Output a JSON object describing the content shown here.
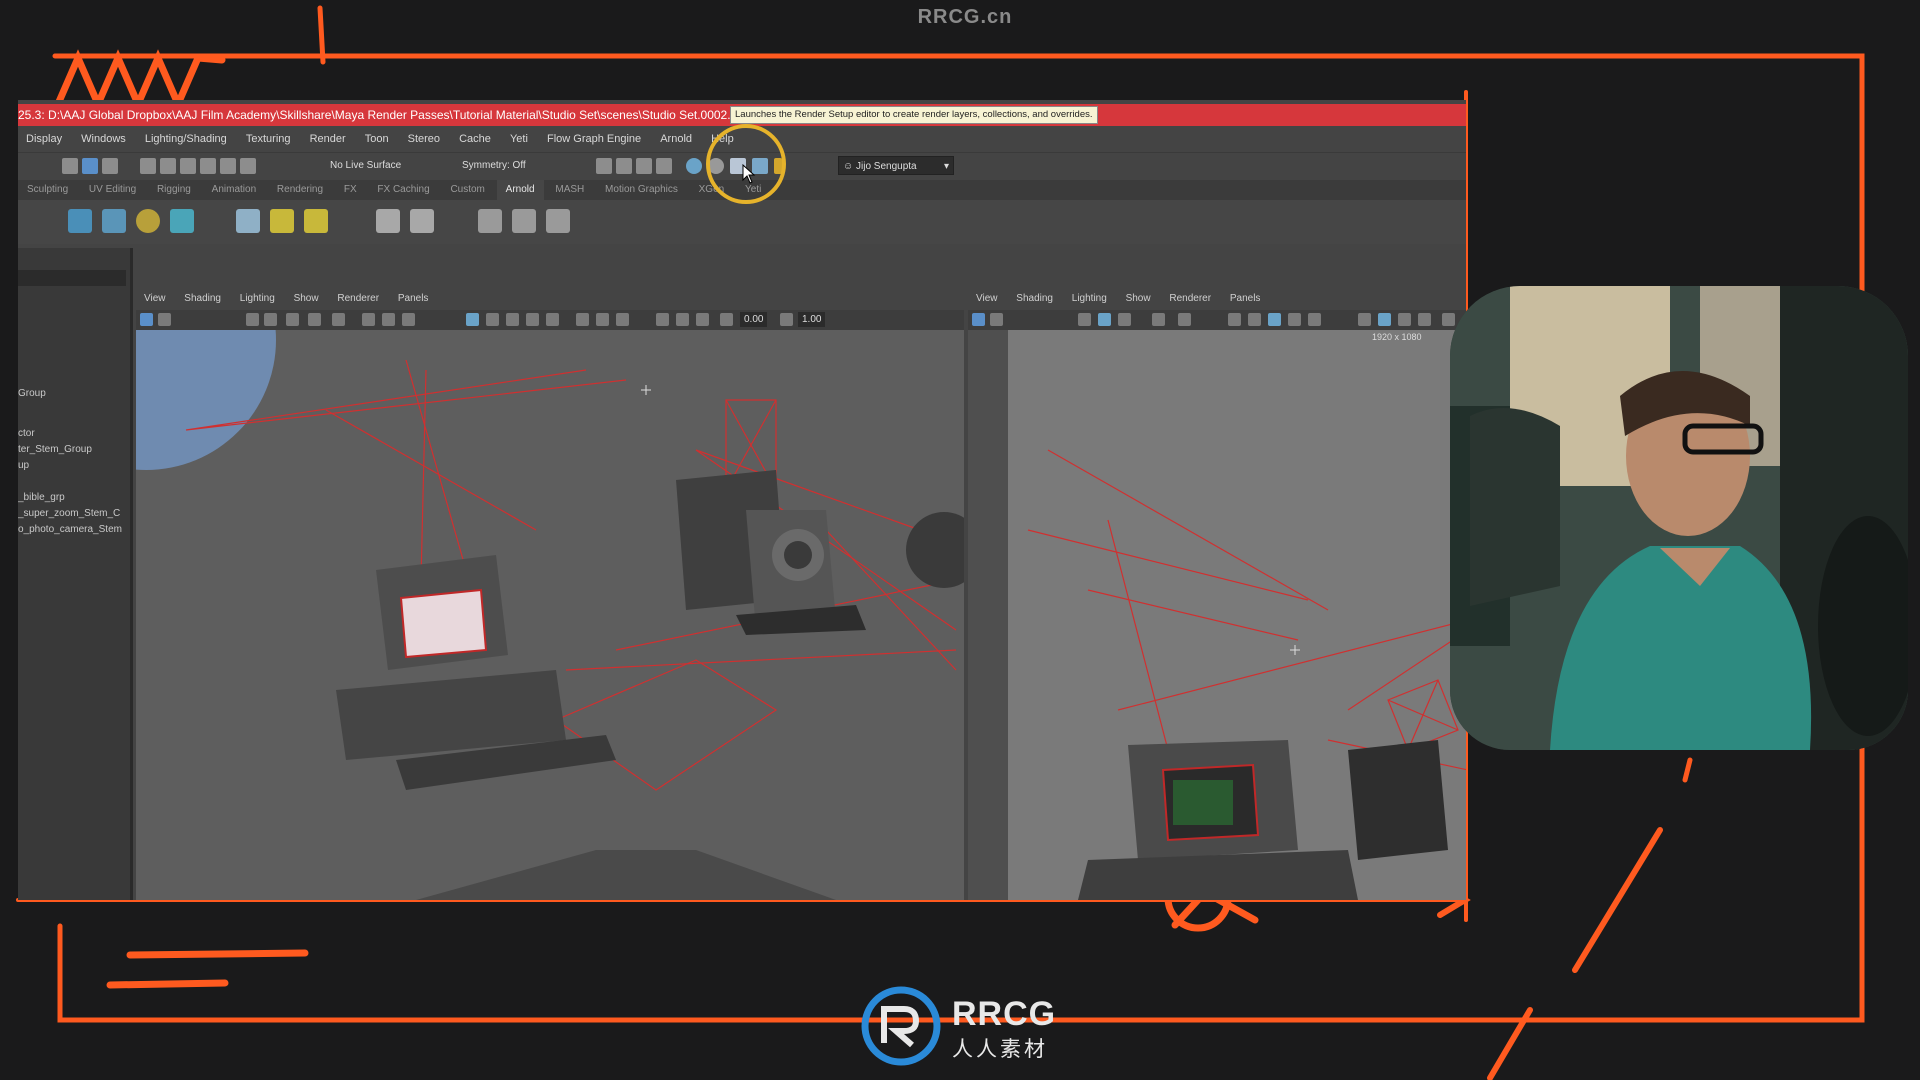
{
  "site_watermark": "RRCG.cn",
  "maya": {
    "title": "25.3: D:\\AAJ Global Dropbox\\AAJ Film Academy\\Skillshare\\Maya Render Passes\\Tutorial Material\\Studio Set\\scenes\\Studio Set.0002.ma",
    "menus": [
      "Display",
      "Windows",
      "Lighting/Shading",
      "Texturing",
      "Render",
      "Toon",
      "Stereo",
      "Cache",
      "Yeti",
      "Flow Graph Engine",
      "Arnold",
      "Help"
    ],
    "toolbar": {
      "live_surface": "No Live Surface",
      "symmetry": "Symmetry: Off",
      "user": "Jijo Sengupta"
    },
    "shelf_tabs": [
      "Sculpting",
      "UV Editing",
      "Rigging",
      "Animation",
      "Rendering",
      "FX",
      "FX Caching",
      "Custom",
      "Arnold",
      "MASH",
      "Motion Graphics",
      "XGen",
      "Yeti"
    ],
    "active_shelf_tab": "Arnold",
    "tooltip": "Launches the Render Setup editor to create render layers, collections, and overrides.",
    "outliner_items": [
      "Group",
      "ctor",
      "ter_Stem_Group",
      "up",
      "_bible_grp",
      "_super_zoom_Stem_C",
      "o_photo_camera_Stem"
    ],
    "viewport_left": {
      "menus": [
        "View",
        "Shading",
        "Lighting",
        "Show",
        "Renderer",
        "Panels"
      ],
      "field_a": "0.00",
      "field_b": "1.00"
    },
    "viewport_right": {
      "menus": [
        "View",
        "Shading",
        "Lighting",
        "Show",
        "Renderer",
        "Panels"
      ],
      "resolution_gate": "1920 x 1080"
    }
  },
  "logo": {
    "text_en": "RRCG",
    "text_cn": "人人素材"
  },
  "colors": {
    "accent_orange": "#ff5a1f",
    "title_red": "#d6373c",
    "highlight_yellow": "#e6b32b"
  }
}
